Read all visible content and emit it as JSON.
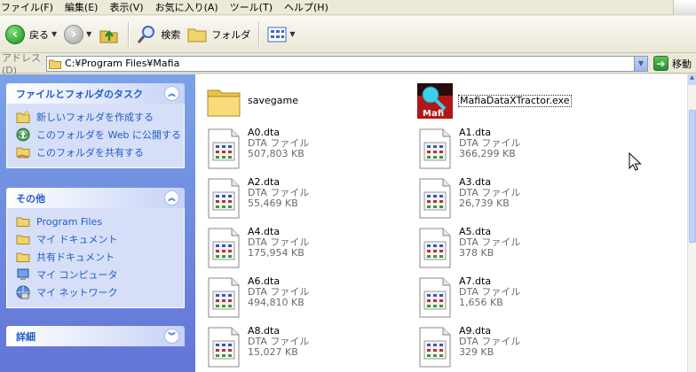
{
  "menu": [
    "ファイル(F)",
    "編集(E)",
    "表示(V)",
    "お気に入り(A)",
    "ツール(T)",
    "ヘルプ(H)"
  ],
  "toolbar": {
    "back_label": "戻る",
    "search_label": "検索",
    "folders_label": "フォルダ"
  },
  "address": {
    "label": "アドレス(D)",
    "value": "C:¥Program Files¥Mafia",
    "go_label": "移動"
  },
  "tasks_panel": {
    "title": "ファイルとフォルダのタスク",
    "items": [
      {
        "label": "新しいフォルダを作成する",
        "icon": "new-folder-icon"
      },
      {
        "label": "このフォルダを Web に公開する",
        "icon": "publish-web-icon"
      },
      {
        "label": "このフォルダを共有する",
        "icon": "share-folder-icon"
      }
    ]
  },
  "other_panel": {
    "title": "その他",
    "items": [
      {
        "label": "Program Files",
        "icon": "folder-icon"
      },
      {
        "label": "マイ ドキュメント",
        "icon": "folder-icon"
      },
      {
        "label": "共有ドキュメント",
        "icon": "folder-icon"
      },
      {
        "label": "マイ コンピュータ",
        "icon": "computer-icon"
      },
      {
        "label": "マイ ネットワーク",
        "icon": "network-icon"
      }
    ]
  },
  "details_panel": {
    "title": "詳細"
  },
  "files": [
    {
      "name": "savegame",
      "type": "",
      "size": "",
      "icon": "folder-icon"
    },
    {
      "name": "MafiaDataXTractor.exe",
      "type": "",
      "size": "",
      "icon": "app-icon"
    },
    {
      "name": "A0.dta",
      "type": "DTA ファイル",
      "size": "507,803 KB",
      "icon": "file-icon"
    },
    {
      "name": "A1.dta",
      "type": "DTA ファイル",
      "size": "366,299 KB",
      "icon": "file-icon"
    },
    {
      "name": "A2.dta",
      "type": "DTA ファイル",
      "size": "55,469 KB",
      "icon": "file-icon"
    },
    {
      "name": "A3.dta",
      "type": "DTA ファイル",
      "size": "26,739 KB",
      "icon": "file-icon"
    },
    {
      "name": "A4.dta",
      "type": "DTA ファイル",
      "size": "175,954 KB",
      "icon": "file-icon"
    },
    {
      "name": "A5.dta",
      "type": "DTA ファイル",
      "size": "378 KB",
      "icon": "file-icon"
    },
    {
      "name": "A6.dta",
      "type": "DTA ファイル",
      "size": "494,810 KB",
      "icon": "file-icon"
    },
    {
      "name": "A7.dta",
      "type": "DTA ファイル",
      "size": "1,656 KB",
      "icon": "file-icon"
    },
    {
      "name": "A8.dta",
      "type": "DTA ファイル",
      "size": "15,027 KB",
      "icon": "file-icon"
    },
    {
      "name": "A9.dta",
      "type": "DTA ファイル",
      "size": "329 KB",
      "icon": "file-icon"
    }
  ]
}
